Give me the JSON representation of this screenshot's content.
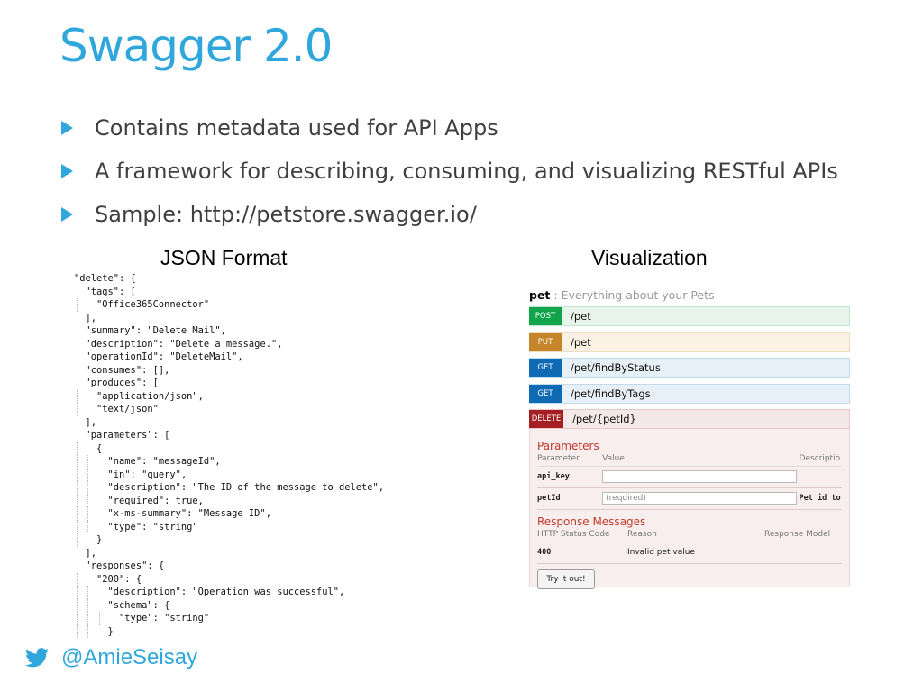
{
  "title": "Swagger 2.0",
  "bullets": [
    "Contains metadata used for API Apps",
    "A framework for describing, consuming, and visualizing RESTful APIs",
    "Sample: http://petstore.swagger.io/"
  ],
  "columns": {
    "json": "JSON Format",
    "visual": "Visualization"
  },
  "code_lines": [
    "\"delete\": {",
    "  \"tags\": [",
    "    \"Office365Connector\"",
    "  ],",
    "  \"summary\": \"Delete Mail\",",
    "  \"description\": \"Delete a message.\",",
    "  \"operationId\": \"DeleteMail\",",
    "  \"consumes\": [],",
    "  \"produces\": [",
    "    \"application/json\",",
    "    \"text/json\"",
    "  ],",
    "  \"parameters\": [",
    "    {",
    "      \"name\": \"messageId\",",
    "      \"in\": \"query\",",
    "      \"description\": \"The ID of the message to delete\",",
    "      \"required\": true,",
    "      \"x-ms-summary\": \"Message ID\",",
    "      \"type\": \"string\"",
    "    }",
    "  ],",
    "  \"responses\": {",
    "    \"200\": {",
    "      \"description\": \"Operation was successful\",",
    "      \"schema\": {",
    "        \"type\": \"string\"",
    "      }"
  ],
  "swagger": {
    "resource": "pet",
    "resource_desc": " : Everything about your Pets",
    "operations": [
      {
        "verb": "POST",
        "path": "/pet",
        "kind": "post"
      },
      {
        "verb": "PUT",
        "path": "/pet",
        "kind": "put"
      },
      {
        "verb": "GET",
        "path": "/pet/findByStatus",
        "kind": "get"
      },
      {
        "verb": "GET",
        "path": "/pet/findByTags",
        "kind": "get"
      },
      {
        "verb": "DELETE",
        "path": "/pet/{petId}",
        "kind": "del"
      }
    ],
    "parameters_title": "Parameters",
    "param_headers": [
      "Parameter",
      "Value",
      "Descriptio"
    ],
    "params": [
      {
        "name": "api_key",
        "value": "",
        "desc": ""
      },
      {
        "name": "petId",
        "value": "(required)",
        "desc": "Pet id to"
      }
    ],
    "responses_title": "Response Messages",
    "response_headers": [
      "HTTP Status Code",
      "Reason",
      "Response Model"
    ],
    "responses": [
      {
        "code": "400",
        "reason": "Invalid pet value"
      }
    ],
    "try_button": "Try it out!"
  },
  "footer": {
    "handle": "@AmieSeisay",
    "icon": "twitter-bird-icon",
    "accent": "#2fa7dc"
  }
}
